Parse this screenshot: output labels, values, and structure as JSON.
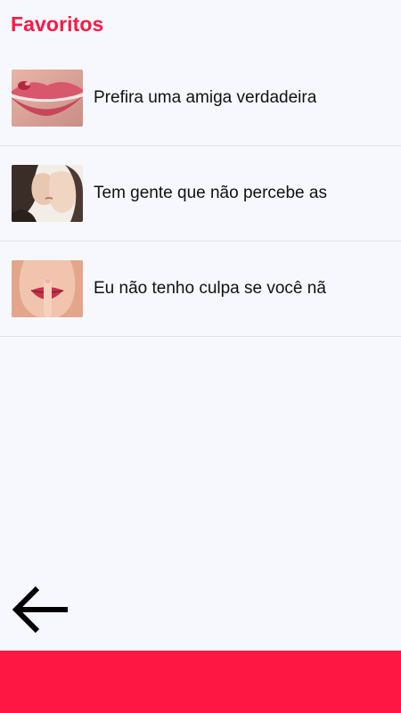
{
  "header": {
    "title": "Favoritos"
  },
  "favorites": [
    {
      "title": "Prefira uma amiga verdadeira",
      "thumb_icon": "lips-image"
    },
    {
      "title": "Tem gente que não percebe as",
      "thumb_icon": "couple-kiss-image"
    },
    {
      "title": "Eu não tenho culpa se você nã",
      "thumb_icon": "silence-finger-image"
    }
  ],
  "navigation": {
    "back_icon": "arrow-left-icon"
  },
  "colors": {
    "accent": "#ff1744",
    "background": "#f7f8fd",
    "divider": "#dfe1e6"
  }
}
